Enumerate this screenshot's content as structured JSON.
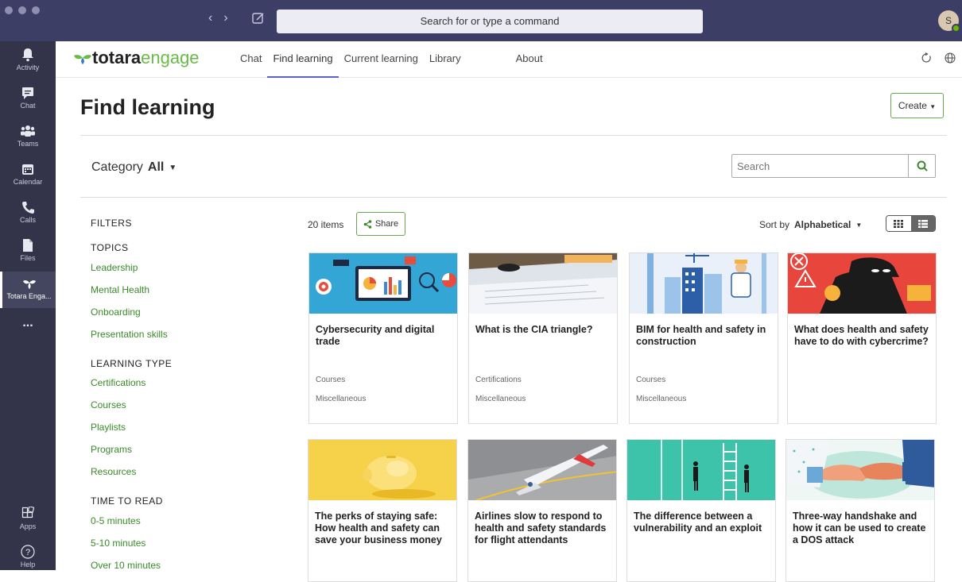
{
  "titlebar": {
    "search_placeholder": "Search for or type a command",
    "avatar_initial": "S"
  },
  "rail": {
    "items": [
      {
        "label": "Activity",
        "icon": "bell-icon"
      },
      {
        "label": "Chat",
        "icon": "chat-icon"
      },
      {
        "label": "Teams",
        "icon": "teams-icon"
      },
      {
        "label": "Calendar",
        "icon": "calendar-icon"
      },
      {
        "label": "Calls",
        "icon": "phone-icon"
      },
      {
        "label": "Files",
        "icon": "file-icon"
      },
      {
        "label": "Totara Enga...",
        "icon": "totara-icon"
      },
      {
        "label": "...",
        "icon": "more-icon"
      }
    ],
    "bottom": [
      {
        "label": "Apps",
        "icon": "apps-icon"
      },
      {
        "label": "Help",
        "icon": "help-icon"
      }
    ]
  },
  "appbar": {
    "logo_bold": "totara",
    "logo_light": "engage",
    "tabs": [
      "Chat",
      "Find learning",
      "Current learning",
      "Library",
      "About"
    ]
  },
  "page": {
    "title": "Find learning",
    "create_label": "Create",
    "category_label": "Category",
    "category_value": "All",
    "search_placeholder": "Search"
  },
  "filters": {
    "heading": "FILTERS",
    "groups": [
      {
        "title": "TOPICS",
        "items": [
          "Leadership",
          "Mental Health",
          "Onboarding",
          "Presentation skills"
        ]
      },
      {
        "title": "LEARNING TYPE",
        "items": [
          "Certifications",
          "Courses",
          "Playlists",
          "Programs",
          "Resources"
        ]
      },
      {
        "title": "TIME TO READ",
        "items": [
          "0-5 minutes",
          "5-10 minutes",
          "Over 10 minutes"
        ]
      }
    ]
  },
  "results": {
    "count": "20 items",
    "share_label": "Share",
    "sort_label": "Sort by",
    "sort_value": "Alphabetical"
  },
  "cards": [
    {
      "title": "Cybersecurity and digital trade",
      "type": "Courses",
      "category": "Miscellaneous",
      "thumb": "analytics-illustration"
    },
    {
      "title": "What is the CIA triangle?",
      "type": "Certifications",
      "category": "Miscellaneous",
      "thumb": "documents-photo"
    },
    {
      "title": "BIM for health and safety in construction",
      "type": "Courses",
      "category": "Miscellaneous",
      "thumb": "construction-illustration"
    },
    {
      "title": "What does health and safety have to do with cybercrime?",
      "type": "",
      "category": "",
      "thumb": "cybercrime-illustration"
    },
    {
      "title": "The perks of staying safe: How health and safety can save your business money",
      "type": "",
      "category": "",
      "thumb": "piggy-bank-photo"
    },
    {
      "title": "Airlines slow to respond to health and safety standards for flight attendants",
      "type": "",
      "category": "",
      "thumb": "airplane-photo"
    },
    {
      "title": "The difference between a vulnerability and an exploit",
      "type": "",
      "category": "",
      "thumb": "ladder-illustration"
    },
    {
      "title": "Three-way handshake and how it can be used to create a DOS attack",
      "type": "",
      "category": "",
      "thumb": "handshake-illustration"
    }
  ],
  "colors": {
    "accent_green": "#3a8a2a",
    "teams_purple": "#5b5fc7",
    "titlebar": "#3d3e66",
    "rail": "#33344a"
  }
}
